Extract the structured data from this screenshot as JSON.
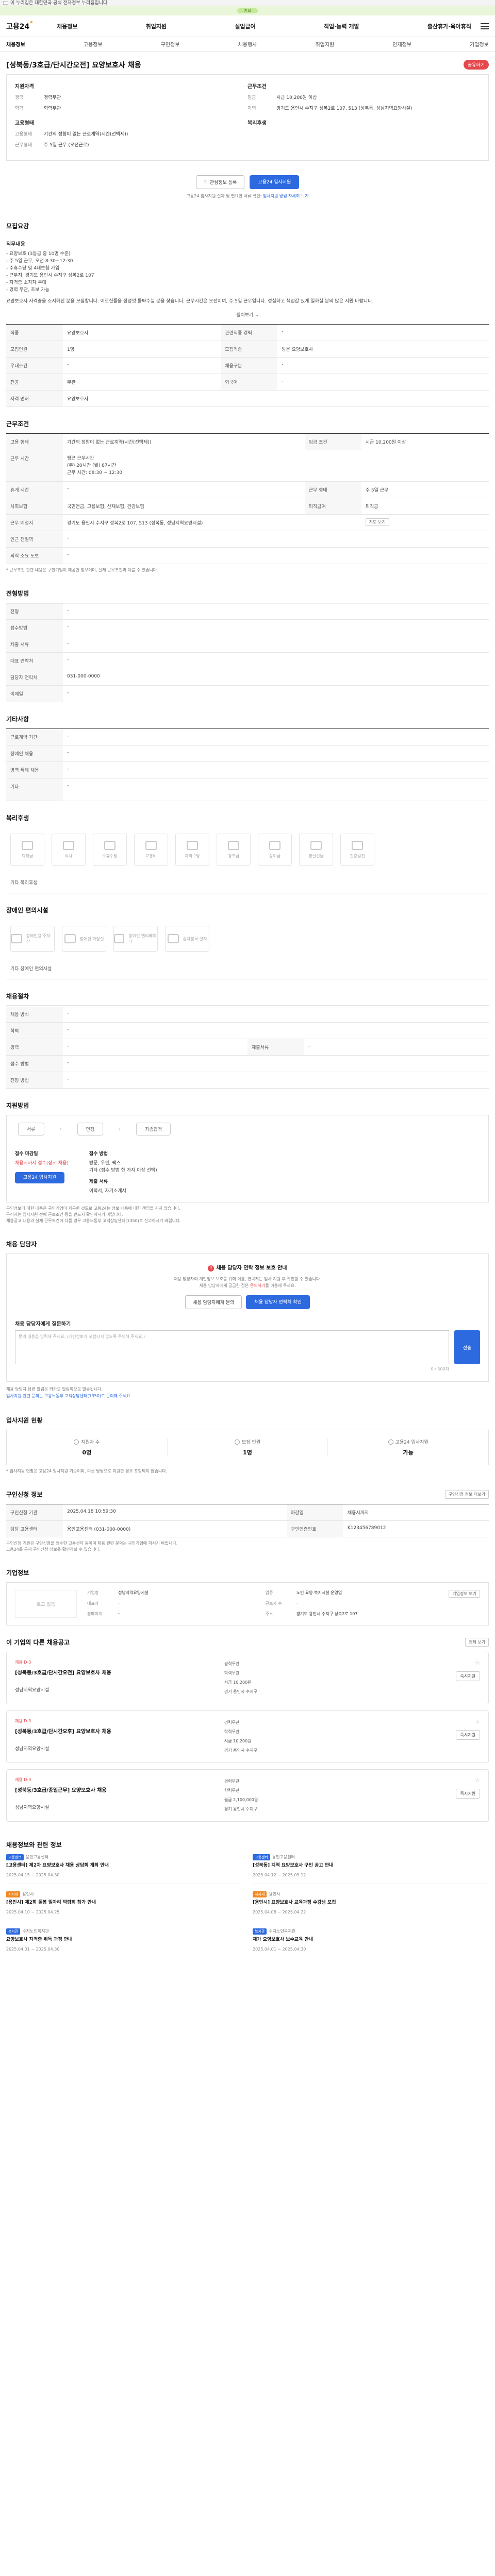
{
  "gov_banner": "이 누리집은 대한민국 공식 전자정부 누리집입니다.",
  "promo": "기획",
  "header": {
    "logo": "고용24",
    "gnb": [
      "채용정보",
      "취업지원",
      "실업급여",
      "직업·능력 개발",
      "출산휴가·육아휴직"
    ]
  },
  "subtabs": [
    "채용정보",
    "고용정보",
    "구인정보",
    "채용행사",
    "취업지원",
    "인재정보",
    "기업정보"
  ],
  "job": {
    "title": "[성북동/3호급/단시간오전] 요양보호사 채용",
    "share_label": "공유하기",
    "summary": {
      "left_title": "지원자격",
      "left": [
        {
          "k": "경력",
          "v": "경력무관"
        },
        {
          "k": "학력",
          "v": "학력무관"
        }
      ],
      "left2_title": "고용형태",
      "left2": [
        {
          "k": "고용형태",
          "v": "기간의 정함이 없는 근로계약(시간(선택제))"
        },
        {
          "k": "근무형태",
          "v": "주 5일 근무 (오전근로)"
        }
      ],
      "right_title": "근무조건",
      "right": [
        {
          "k": "임금",
          "v": "시급 10,200원 이상"
        },
        {
          "k": "지역",
          "v": "경기도 용인시 수지구 성복2로 107, 513 (성복동, 성남지역요양시설)"
        }
      ],
      "right2_title": "복리후생",
      "right2": [
        {
          "k": "",
          "v": ""
        }
      ]
    },
    "cta": {
      "scrap": "관심정보 등록",
      "apply": "고용24 입사지원",
      "note_prefix": "고용24 입사지원 절차 및 필요한 서류 확인:",
      "note_link": "입사지원 방법 자세히 보기"
    }
  },
  "detail": {
    "title": "모집요강",
    "subtitle": "직무내용",
    "body": "- 요양보호 (3등급 중 10명 수준)\n- 주 5일 근무, 오전 8:30~12:30\n- 주휴수당 및 4대보험 가입\n- 근무지: 경기도 용인시 수지구 성복2로 107\n- 자격증 소지자 우대\n- 경력 무관, 초보 가능",
    "paragraph": "요양보호사 자격증을 소지하신 분을 모집합니다. 어르신들을 정성껏 돌봐주실 분을 찾습니다. 근무시간은 오전이며, 주 5일 근무입니다. 성실하고 책임감 있게 일하실 분의 많은 지원 바랍니다.",
    "more": "펼쳐보기",
    "table": [
      {
        "k": "직종",
        "v": "요양보호사",
        "k2": "관련직종 경력",
        "v2": "-"
      },
      {
        "k": "모집인원",
        "v": "1명",
        "k2": "모집직종",
        "v2": "방문 요양보호사"
      },
      {
        "k": "우대조건",
        "v": "-",
        "k2": "채용구분",
        "v2": "-"
      },
      {
        "k": "전공",
        "v": "무관",
        "k2": "외국어",
        "v2": "-"
      },
      {
        "k": "자격 면허",
        "v": "요양보호사",
        "k2": "",
        "v2": ""
      }
    ]
  },
  "conditions": {
    "title": "근무조건",
    "rows": [
      {
        "k": "고용 형태",
        "v": "기간의 정함이 없는 근로계약(시간(선택제))",
        "k2": "임금 조건",
        "v2": "시급 10,200원 이상"
      },
      {
        "k": "근무 시간",
        "v": "평균 근무시간\n(주) 20시간 (월) 87시간\n근무 시간: 08:30 ~ 12:30",
        "k2": "",
        "v2": ""
      },
      {
        "k": "휴게 시간",
        "v": "-",
        "k2": "근무 형태",
        "v2": "주 5일 근무"
      },
      {
        "k": "사회보험",
        "v": "국민연금, 고용보험, 산재보험, 건강보험",
        "k2": "퇴직급여",
        "v2": "퇴직금"
      },
      {
        "k": "근무 예정지",
        "v": "경기도 용인시 수지구 성복2로 107, 513 (성복동, 성남지역요양시설)",
        "k2": "지도 보기",
        "v2": ""
      },
      {
        "k": "인근 전철역",
        "v": "-",
        "k2": "",
        "v2": ""
      },
      {
        "k": "퇴직 소요 도보",
        "v": "-",
        "k2": "",
        "v2": ""
      }
    ],
    "note": "* 근무조건 관련 내용은 구인기업이 제공한 정보이며, 실제 근무조건과 다를 수 있습니다."
  },
  "welfare_intro": {
    "title": "전형방법",
    "rows": [
      {
        "k": "전형",
        "v": "-"
      },
      {
        "k": "접수방법",
        "v": "-"
      },
      {
        "k": "제출 서류",
        "v": "-"
      },
      {
        "k": "대표 연락처",
        "v": "-"
      },
      {
        "k": "담당자 연락처",
        "v": "031-000-0000"
      },
      {
        "k": "이메일",
        "v": "-"
      }
    ]
  },
  "company_simple": {
    "title": "기타사항",
    "rows": [
      {
        "k": "근로계약 기간",
        "v": "-"
      },
      {
        "k": "장애인 채용",
        "v": "-"
      },
      {
        "k": "병역 특례 채용",
        "v": "-"
      },
      {
        "k": "기타",
        "v": "-"
      }
    ]
  },
  "benefits": {
    "title": "복리후생",
    "items": [
      "퇴직금",
      "식사",
      "주휴수당",
      "교통비",
      "자격수당",
      "경조금",
      "상여금",
      "명절선물",
      "건강검진"
    ],
    "extra": "기타 복리후생"
  },
  "disability": {
    "title": "장애인 편의시설",
    "items": [
      "장애인용 주차장",
      "장애인 화장실",
      "장애인 엘리베이터",
      "점자블록 설치"
    ],
    "extra": "기타 장애인 편의시설"
  },
  "selection": {
    "title": "채용절차",
    "rows": [
      {
        "k": "채용 방식",
        "v": "-",
        "k2": "",
        "v2": ""
      },
      {
        "k": "학력",
        "v": "-",
        "k2": "",
        "v2": ""
      },
      {
        "k": "경력",
        "v": "-",
        "k2": "제출서류",
        "v2": "-"
      },
      {
        "k": "접수 방법",
        "v": "-",
        "k2": "",
        "v2": ""
      },
      {
        "k": "전형 방법",
        "v": "-",
        "k2": "",
        "v2": ""
      }
    ]
  },
  "process": {
    "title": "지원방법",
    "steps": [
      "서류",
      "면접",
      "최종합격"
    ],
    "col1_title": "접수 마감일",
    "col1": "채용시까지 접수(상시 채용)",
    "col2_title": "접수 방법",
    "col2": "방문, 우편, 팩스\n기타 (접수 방법 한 가지 이상 선택)",
    "col3_title": "제출 서류",
    "col3": "이력서, 자기소개서",
    "apply_btn": "고용24 입사지원",
    "notes": [
      "구인정보에 대한 내용은 구인기업이 제공한 것으로 고용24는 정보 내용에 대한 책임을 지지 않습니다.",
      "구직자는 입사지원 전에 근로조건 등을 반드시 확인하시기 바랍니다.",
      "채용공고 내용과 실제 근무조건이 다를 경우 고용노동부 고객상담센터(1350)로 신고하시기 바랍니다."
    ]
  },
  "contact": {
    "title": "채용 담당자",
    "warn": "채용 담당자 연락 정보 보호 안내",
    "text1": "채용 담당자의 개인정보 보호를 위해 이름, 연락처는 입사 지원 후 확인할 수 있습니다.",
    "text2_prefix": "채용 담당자에게 궁금한 점은",
    "text2_link": "문의하기",
    "text2_suffix": "를 이용해 주세요.",
    "btn1": "채용 담당자에게 문의",
    "btn2": "채용 담당자 연락처 확인",
    "q_label": "채용 담당자에게 질문하기",
    "q_placeholder": "문의 내용을 입력해 주세요. (개인정보가 포함되지 않도록 주의해 주세요.)",
    "send": "전송",
    "counter": "0 / 500자",
    "bullets": [
      "채용 담당자 답변 알림은 카카오 알림톡으로 발송됩니다.",
      "입사지원 관련 문의는 고용노동부 고객상담센터(1350)로 문의해 주세요."
    ]
  },
  "status": {
    "title": "입사지원 현황",
    "cols": [
      {
        "lbl": "지원자 수",
        "val": "0명"
      },
      {
        "lbl": "모집 인원",
        "val": "1명"
      },
      {
        "lbl": "고용24 입사지원",
        "val": "가능"
      }
    ],
    "note": "* 입사지원 현황은 고용24 입사지원 기준이며, 다른 방법으로 지원한 경우 포함되지 않습니다."
  },
  "register": {
    "title": "구인신청 정보",
    "link": "구인신청 정보 더보기",
    "rows": [
      {
        "k": "구인신청 기관",
        "v": "2025.04.18 10:59:30",
        "k2": "마감일",
        "v2": "채용시까지"
      },
      {
        "k": "담당 고용센터",
        "v": "용인고용센터 (031-000-0000)",
        "k2": "구인인증번호",
        "v2": "K123456789012"
      }
    ],
    "notes": [
      "구인신청 기관은 구인신청을 접수한 고용센터 등이며 채용 관련 문의는 구인기업에 하시기 바랍니다.",
      "고용24를 통해 구인신청 정보를 확인하실 수 있습니다."
    ]
  },
  "company": {
    "title": "기업정보",
    "logo_alt": "로고 없음",
    "btn": "기업정보 보기",
    "fields": [
      {
        "k": "기업명",
        "v": "성남지역요양시설"
      },
      {
        "k": "업종",
        "v": "노인 요양 복지시설 운영업"
      },
      {
        "k": "대표자",
        "v": "-"
      },
      {
        "k": "근로자 수",
        "v": "-"
      },
      {
        "k": "홈페이지",
        "v": "-"
      },
      {
        "k": "주소",
        "v": "경기도 용인시 수지구 성복2로 107"
      }
    ]
  },
  "similar": {
    "title": "이 기업의 다른 채용공고",
    "link": "전체 보기",
    "cards": [
      {
        "badge": "채용 D-3",
        "title": "[성북동/3호급/단시간오전] 요양보호사 채용",
        "company": "성남지역요양시설",
        "m1": "경력무관",
        "m2": "학력무관",
        "m3": "시급 10,200원",
        "m4": "경기 용인시 수지구",
        "apply": "즉시지원"
      },
      {
        "badge": "채용 D-3",
        "title": "[성북동/3호급/단시간오후] 요양보호사 채용",
        "company": "성남지역요양시설",
        "m1": "경력무관",
        "m2": "학력무관",
        "m3": "시급 10,200원",
        "m4": "경기 용인시 수지구",
        "apply": "즉시지원"
      },
      {
        "badge": "채용 D-3",
        "title": "[성북동/3호급/종일근무] 요양보호사 채용",
        "company": "성남지역요양시설",
        "m1": "경력무관",
        "m2": "학력무관",
        "m3": "월급 2,100,000원",
        "m4": "경기 용인시 수지구",
        "apply": "즉시지원"
      }
    ]
  },
  "news": {
    "title": "채용정보와 관련 정보",
    "items": [
      {
        "tag": "고용센터",
        "head": "용인고용센터",
        "title": "[고용센터] 제2차 요양보호사 채용 상담회 개최 안내",
        "meta": "2025.04.15 ~ 2025.04.30"
      },
      {
        "tag": "고용센터",
        "head": "용인고용센터",
        "title": "[성북동] 지역 요양보호사 구인 공고 안내",
        "meta": "2025.04.12 ~ 2025.05.12"
      },
      {
        "tag": "지자체",
        "head": "용인시",
        "title": "[용인시] 제2회 돌봄 일자리 박람회 참가 안내",
        "meta": "2025.04.10 ~ 2025.04.25"
      },
      {
        "tag": "지자체",
        "head": "용인시",
        "title": "[용인시] 요양보호사 교육과정 수강생 모집",
        "meta": "2025.04.08 ~ 2025.04.22"
      },
      {
        "tag": "복지관",
        "head": "수지노인복지관",
        "title": "요양보호사 자격증 취득 과정 안내",
        "meta": "2025.04.01 ~ 2025.04.30"
      },
      {
        "tag": "복지관",
        "head": "수지노인복지관",
        "title": "재가 요양보호사 보수교육 안내",
        "meta": "2025.04.01 ~ 2025.04.30"
      }
    ]
  }
}
